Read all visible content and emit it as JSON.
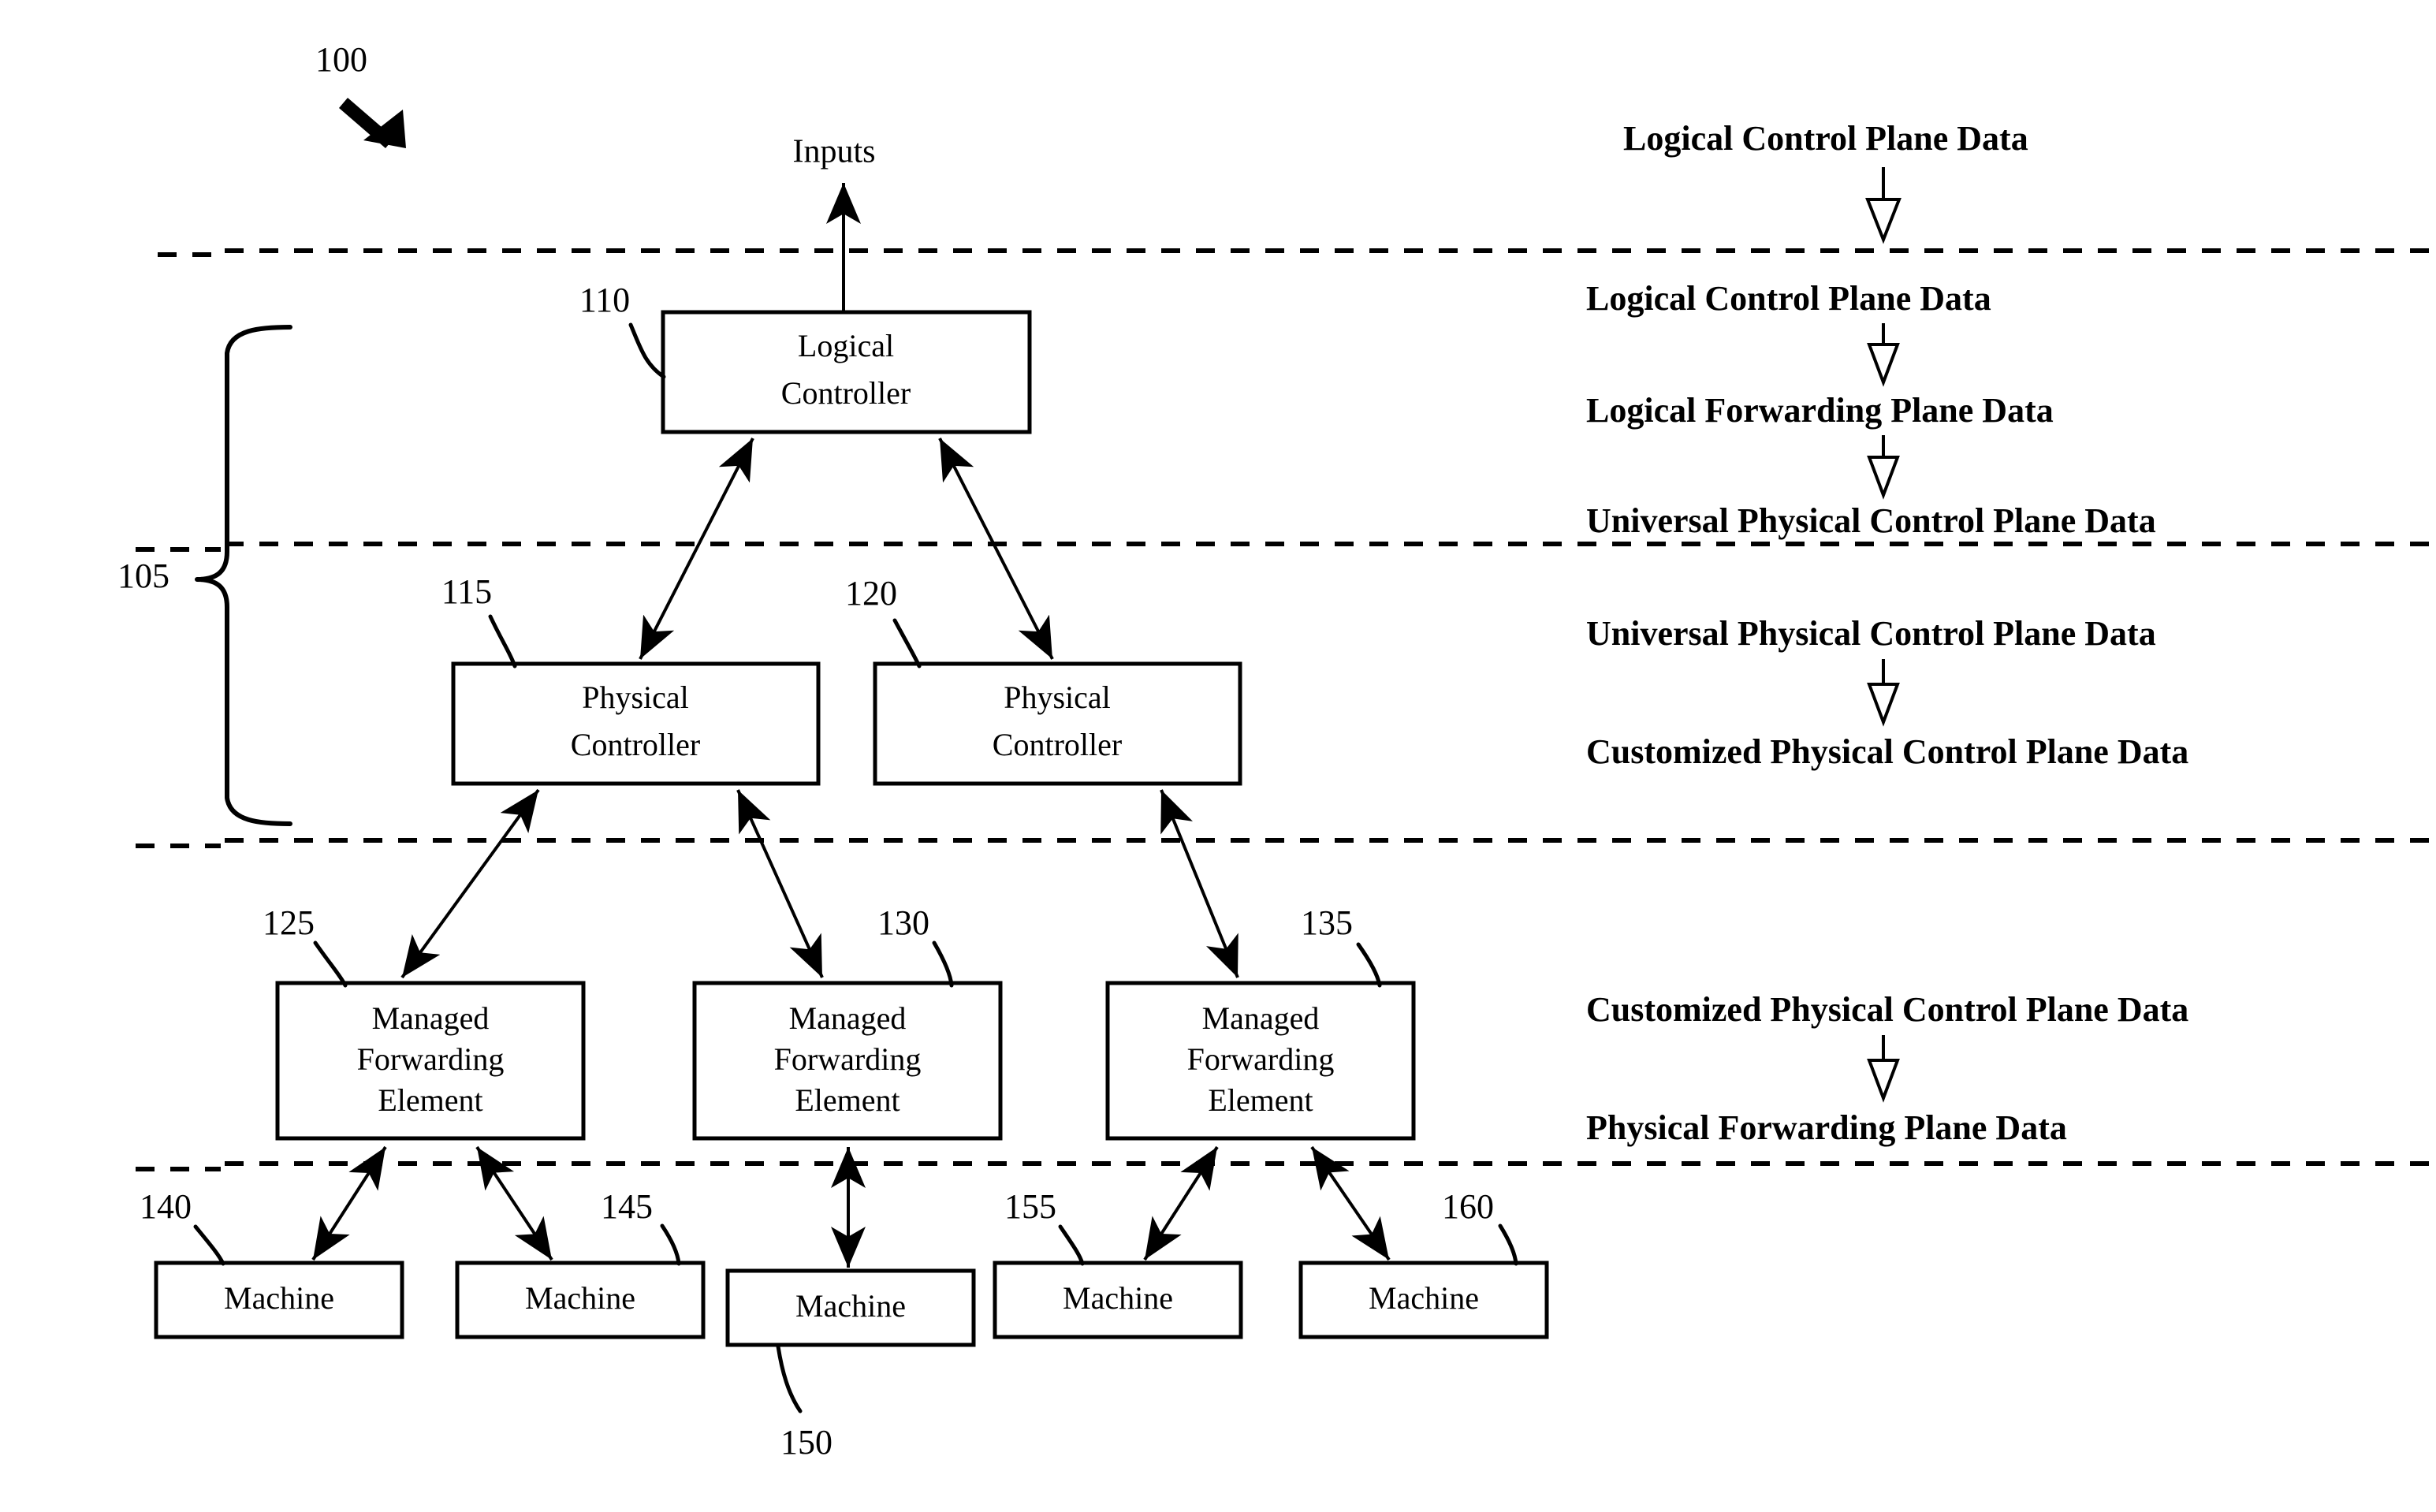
{
  "figure": {
    "reference_numeral": "100",
    "top_input_label": "Inputs",
    "bracket_label": "105"
  },
  "nodes": {
    "logical_controller": {
      "ref": "110",
      "line1": "Logical",
      "line2": "Controller"
    },
    "physical_controller_left": {
      "ref": "115",
      "line1": "Physical",
      "line2": "Controller"
    },
    "physical_controller_right": {
      "ref": "120",
      "line1": "Physical",
      "line2": "Controller"
    },
    "mfe_left": {
      "ref": "125",
      "line1": "Managed",
      "line2": "Forwarding",
      "line3": "Element"
    },
    "mfe_center": {
      "ref": "130",
      "line1": "Managed",
      "line2": "Forwarding",
      "line3": "Element"
    },
    "mfe_right": {
      "ref": "135",
      "line1": "Managed",
      "line2": "Forwarding",
      "line3": "Element"
    },
    "machines": [
      {
        "ref": "140",
        "label": "Machine"
      },
      {
        "ref": "145",
        "label": "Machine"
      },
      {
        "ref": "150",
        "label": "Machine"
      },
      {
        "ref": "155",
        "label": "Machine"
      },
      {
        "ref": "160",
        "label": "Machine"
      }
    ]
  },
  "data_pipeline": {
    "group_1": [
      "Logical Control Plane Data"
    ],
    "group_2": [
      "Logical Control Plane Data",
      "Logical Forwarding Plane Data",
      "Universal Physical Control Plane Data"
    ],
    "group_3": [
      "Universal Physical Control Plane Data",
      "Customized Physical Control Plane Data"
    ],
    "group_4": [
      "Customized Physical Control Plane Data",
      "Physical Forwarding Plane Data"
    ]
  },
  "colors": {
    "stroke": "#000000",
    "background": "#ffffff"
  }
}
